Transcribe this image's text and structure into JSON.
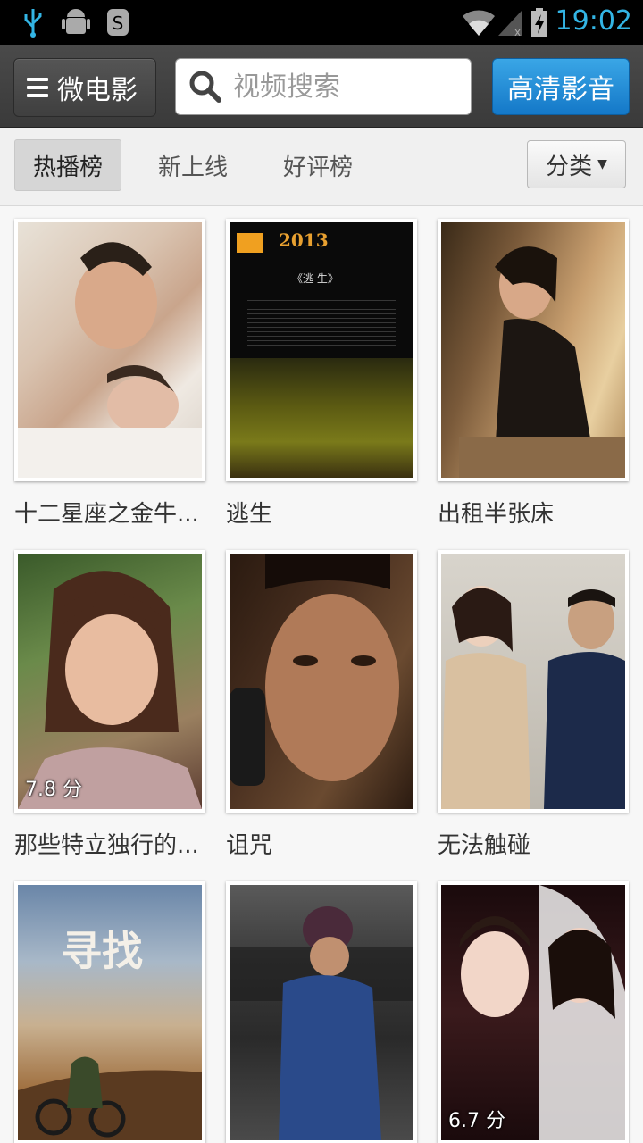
{
  "status_bar": {
    "time": "19:02"
  },
  "header": {
    "menu_label": "微电影",
    "search_placeholder": "视频搜索",
    "hd_button": "高清影音"
  },
  "tabs": [
    {
      "label": "热播榜",
      "active": true
    },
    {
      "label": "新上线",
      "active": false
    },
    {
      "label": "好评榜",
      "active": false
    }
  ],
  "category_button": "分类",
  "videos": [
    {
      "title": "十二星座之金牛...",
      "rating": ""
    },
    {
      "title": "逃生",
      "rating": "",
      "poster_text": [
        "2013",
        "《逃 生》"
      ]
    },
    {
      "title": "出租半张床",
      "rating": ""
    },
    {
      "title": "那些特立独行的...",
      "rating": "7.8 分"
    },
    {
      "title": "诅咒",
      "rating": ""
    },
    {
      "title": "无法触碰",
      "rating": ""
    },
    {
      "title": "",
      "rating": "",
      "poster_text": [
        "寻找"
      ]
    },
    {
      "title": "",
      "rating": ""
    },
    {
      "title": "",
      "rating": "6.7 分"
    }
  ],
  "colors": {
    "accent": "#33b5e5",
    "hd_button": "#1e88d8",
    "actionbar": "#424242"
  }
}
